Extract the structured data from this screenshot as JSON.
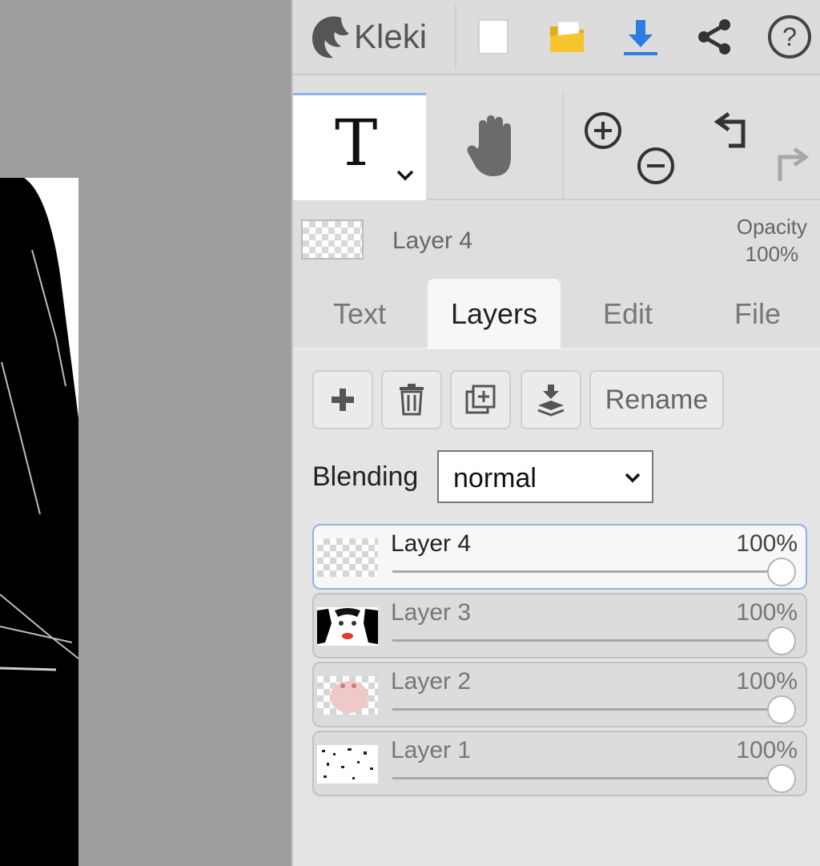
{
  "app": {
    "name": "Kleki"
  },
  "topbar": {
    "icons": [
      "kleki-logo-icon",
      "new-file-icon",
      "open-folder-icon",
      "download-icon",
      "share-icon",
      "help-icon"
    ],
    "colors": {
      "folder": "#f2c028",
      "download": "#2a7de1"
    }
  },
  "tools": {
    "active": "text",
    "text_glyph": "T",
    "icons": [
      "text-tool-icon",
      "chevron-down-icon",
      "hand-tool-icon",
      "zoom-in-icon",
      "zoom-out-icon",
      "undo-icon",
      "redo-icon"
    ]
  },
  "current_layer": {
    "name": "Layer 4",
    "opacity_label": "Opacity",
    "opacity_value": "100%"
  },
  "tabs": [
    {
      "label": "Text",
      "active": false
    },
    {
      "label": "Layers",
      "active": true
    },
    {
      "label": "Edit",
      "active": false
    },
    {
      "label": "File",
      "active": false
    }
  ],
  "layers_panel": {
    "buttons": {
      "rename_label": "Rename"
    },
    "blending": {
      "label": "Blending",
      "value": "normal"
    },
    "layers": [
      {
        "name": "Layer 4",
        "opacity": "100%",
        "opacity_fraction": 1.0,
        "selected": true
      },
      {
        "name": "Layer 3",
        "opacity": "100%",
        "opacity_fraction": 1.0,
        "selected": false
      },
      {
        "name": "Layer 2",
        "opacity": "100%",
        "opacity_fraction": 1.0,
        "selected": false
      },
      {
        "name": "Layer 1",
        "opacity": "100%",
        "opacity_fraction": 1.0,
        "selected": false
      }
    ]
  },
  "colors": {
    "accent": "#8fb3e6",
    "panel_bg": "#dedede",
    "canvas_bg": "#9e9e9e"
  }
}
